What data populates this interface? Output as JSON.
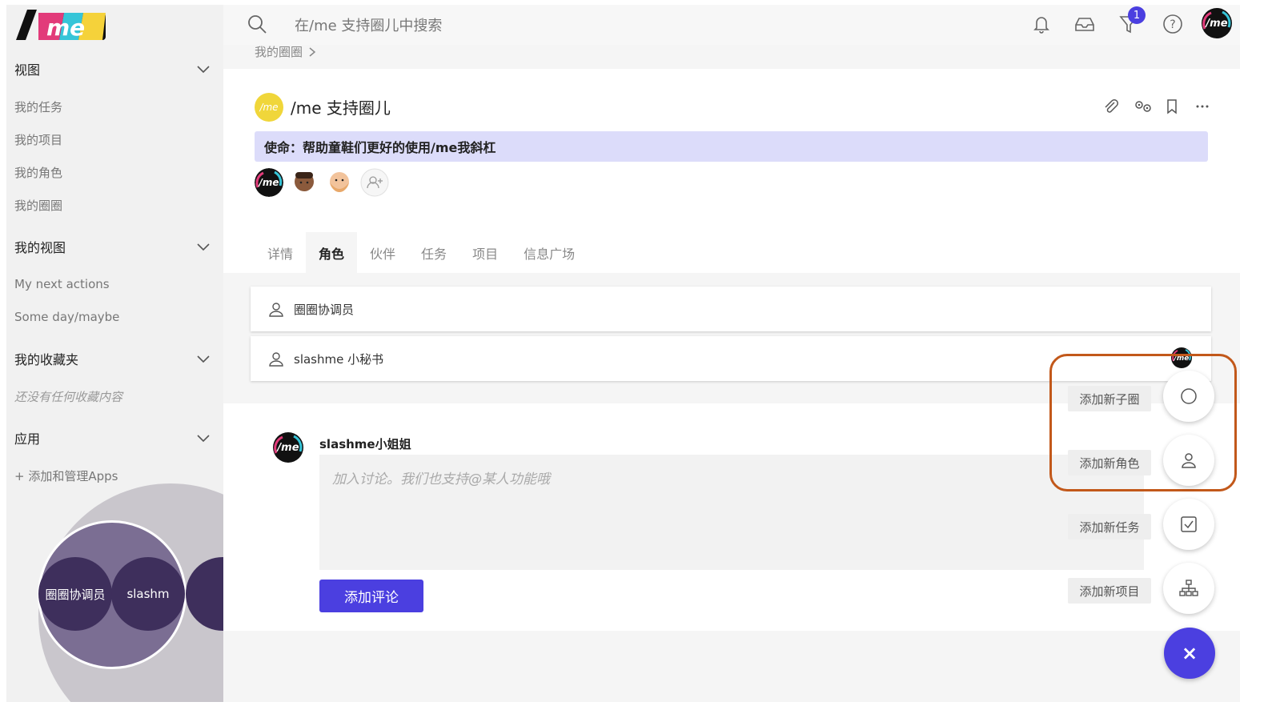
{
  "topbar": {
    "search_placeholder": "在/me 支持圈儿中搜索",
    "notification_count": "1"
  },
  "sidebar": {
    "sections": [
      {
        "label": "视图"
      },
      {
        "label": "我的视图"
      },
      {
        "label": "我的收藏夹"
      },
      {
        "label": "应用"
      }
    ],
    "views": [
      "我的任务",
      "我的项目",
      "我的角色",
      "我的圈圈"
    ],
    "my_views": [
      "My next actions",
      "Some day/maybe"
    ],
    "favorites_empty": "还没有任何收藏内容",
    "apps_link": "+ 添加和管理Apps",
    "bubble_labels": [
      "圈圈协调员",
      "slashm"
    ]
  },
  "breadcrumb": {
    "label": "我的圈圈"
  },
  "circle": {
    "logo_text": "/me",
    "title": "/me 支持圈儿",
    "mission": "使命：帮助童鞋们更好的使用/me我斜杠"
  },
  "tabs": [
    "详情",
    "角色",
    "伙伴",
    "任务",
    "项目",
    "信息广场"
  ],
  "active_tab": "角色",
  "roles": [
    "圈圈协调员",
    "slashme 小秘书"
  ],
  "discussion": {
    "author": "slashme小姐姐",
    "placeholder": "加入讨论。我们也支持@某人功能哦",
    "submit_label": "添加评论"
  },
  "fab_menu": {
    "items": [
      "添加新子圈",
      "添加新角色",
      "添加新任务",
      "添加新项目"
    ],
    "close_label": "×"
  },
  "colors": {
    "accent": "#4b3fe0",
    "mission_bg": "#dcdcfa",
    "highlight": "#c2581a",
    "circle_logo": "#f0d63a"
  }
}
